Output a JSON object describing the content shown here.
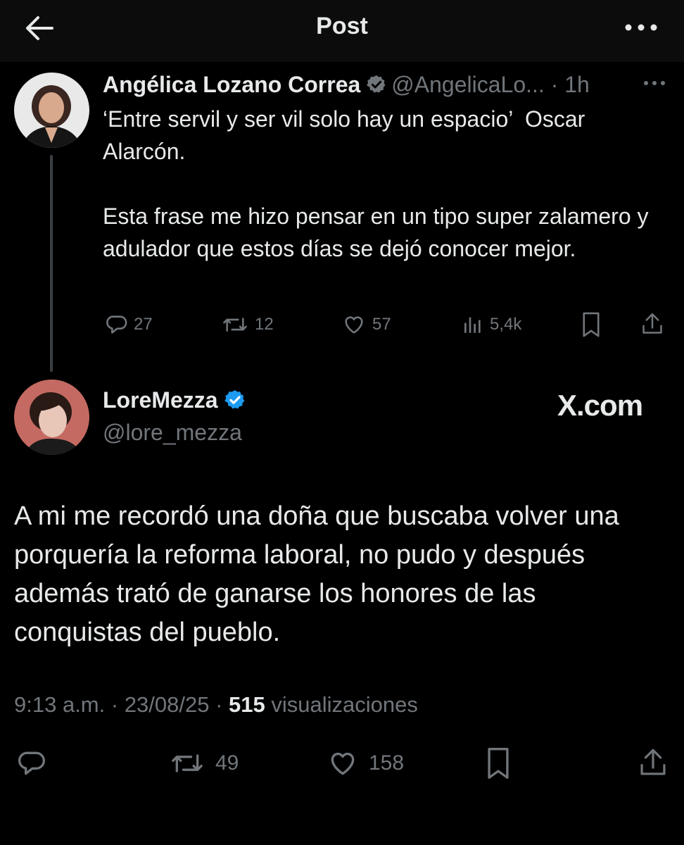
{
  "header": {
    "title": "Post"
  },
  "quoted_post": {
    "author_name": "Angélica Lozano Correa",
    "handle": "@AngelicaLo...",
    "time": "1h",
    "text": "‘Entre servil y ser vil solo hay un espacio’  Oscar Alarcón.\n\nEsta frase me hizo pensar en un tipo super zalamero y adulador que estos días se dejó conocer mejor.",
    "stats": {
      "replies": "27",
      "reposts": "12",
      "likes": "57",
      "views": "5,4k"
    },
    "verified_badge_color": "#71767b"
  },
  "reply_post": {
    "author_name": "LoreMezza",
    "handle": "@lore_mezza",
    "brand": "X.com",
    "verified_badge_color": "#1d9bf0",
    "text": "A mi me recordó una doña que buscaba volver una porquería la reforma laboral, no pudo y después además trató de ganarse los honores de las conquistas del pueblo.",
    "time": "9:13 a.m.",
    "date": "23/08/25",
    "views_count": "515",
    "views_label": "visualizaciones",
    "stats": {
      "reposts": "49",
      "likes": "158"
    }
  },
  "colors": {
    "background": "#000000",
    "text": "#e7e9ea",
    "muted": "#71767b",
    "accent": "#1d9bf0"
  },
  "icons": [
    "back-arrow-icon",
    "more-icon",
    "verified-icon",
    "reply-icon",
    "repost-icon",
    "like-icon",
    "views-icon",
    "bookmark-icon",
    "share-icon"
  ]
}
